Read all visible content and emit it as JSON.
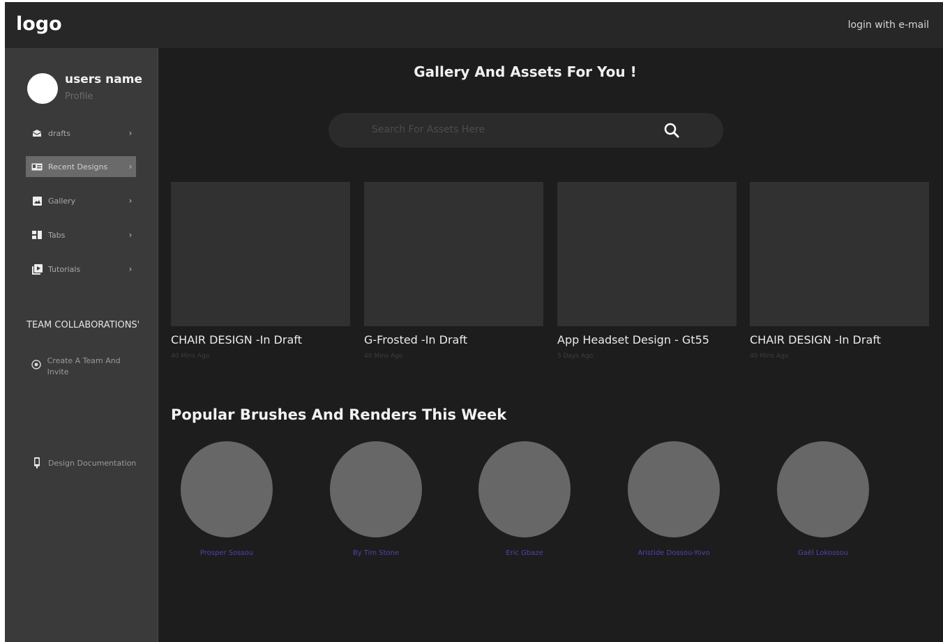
{
  "header": {
    "logo": "logo",
    "login": "login with  e-mail"
  },
  "sidebar": {
    "user_name": "users name",
    "profile_label": "Profile",
    "items": [
      {
        "label": "drafts",
        "icon": "inbox-icon"
      },
      {
        "label": "Recent Designs",
        "icon": "id-card-icon",
        "active": true
      },
      {
        "label": "Gallery",
        "icon": "image-icon"
      },
      {
        "label": "Tabs",
        "icon": "tabs-icon"
      },
      {
        "label": "Tutorials",
        "icon": "video-library-icon"
      }
    ],
    "team_title": "TEAM COLLABORATIONS'",
    "team_invite": "Create A Team And Invite",
    "doc_link": "Design Documentation"
  },
  "main": {
    "title": "Gallery And Assets For You !",
    "search": {
      "placeholder": "Search For Assets Here"
    },
    "cards": [
      {
        "title": "CHAIR DESIGN -In Draft",
        "time": "40 Mins Ago"
      },
      {
        "title": "G-Frosted -In Draft",
        "time": "40 Mins Ago"
      },
      {
        "title": "App Headset Design - Gt55",
        "time": "5 Days Ago"
      },
      {
        "title": "CHAIR DESIGN -In Draft",
        "time": "40 Mins Ago"
      }
    ],
    "popular_title": "Popular Brushes And Renders This Week",
    "artists": [
      {
        "name": "Prosper Sossou"
      },
      {
        "name": "By Tim Stone"
      },
      {
        "name": "Eric Gbaze"
      },
      {
        "name": "Aristide Dossou-Yovo"
      },
      {
        "name": "Gaël Lokossou"
      }
    ]
  },
  "colors": {
    "background": "#1d1d1d",
    "topbar": "#272727",
    "sidebar": "#3a3a3a",
    "card_placeholder": "#313131",
    "artist_placeholder": "#676767",
    "artist_name": "#5a3fb0"
  }
}
